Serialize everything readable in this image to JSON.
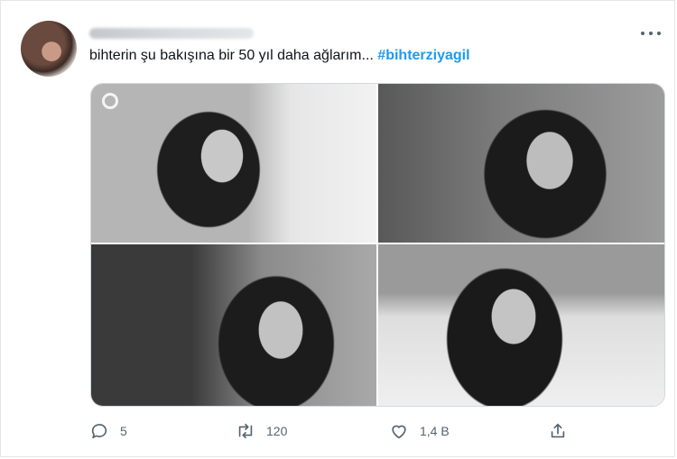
{
  "tweet": {
    "text": "bihterin şu bakışına bir 50 yıl daha ağlarım...",
    "hashtag": "#bihterziyagil"
  },
  "actions": {
    "reply_count": "5",
    "retweet_count": "120",
    "like_count": "1,4 B"
  },
  "icons": [
    "avatar",
    "more-icon",
    "reply-icon",
    "retweet-icon",
    "like-icon",
    "share-icon"
  ],
  "colors": {
    "accent": "#1d9bf0",
    "icon": "#536471",
    "text": "#0f1419"
  }
}
